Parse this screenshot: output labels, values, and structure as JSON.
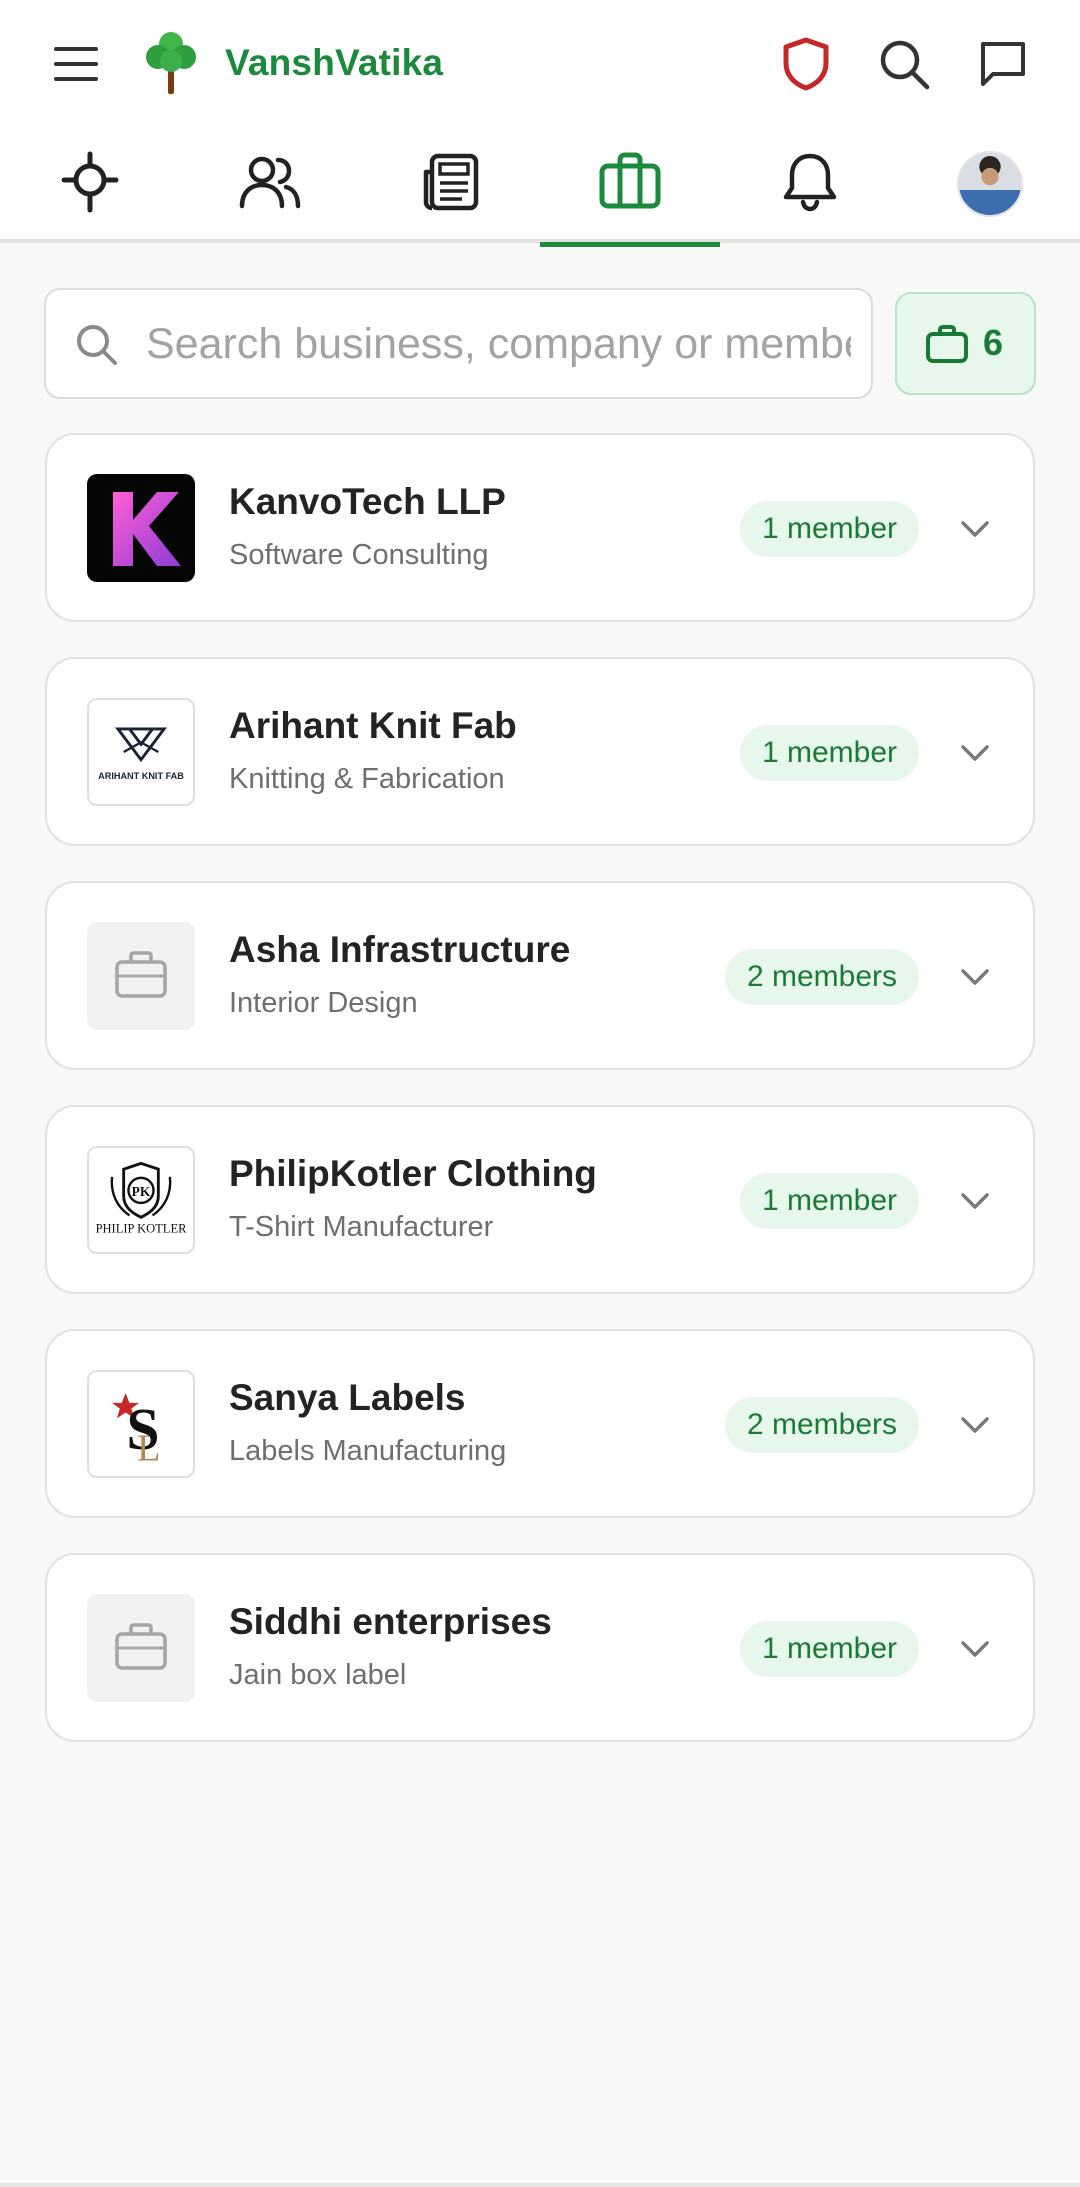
{
  "app": {
    "brand": "VanshVatika",
    "colors": {
      "brand_green": "#1c8a3d",
      "shield_red": "#c62828",
      "badge_bg": "#e8f7ec",
      "badge_text": "#1c7a37"
    }
  },
  "topbar": {
    "icons": [
      "menu-icon",
      "tree-logo",
      "shield-icon",
      "search-icon",
      "chat-icon"
    ]
  },
  "tabs": [
    {
      "id": "tree",
      "icon": "family-tree-icon"
    },
    {
      "id": "people",
      "icon": "people-icon"
    },
    {
      "id": "news",
      "icon": "newspaper-icon"
    },
    {
      "id": "business",
      "icon": "briefcase-icon",
      "active": true
    },
    {
      "id": "notifications",
      "icon": "bell-icon"
    },
    {
      "id": "profile",
      "icon": "avatar"
    }
  ],
  "search": {
    "placeholder": "Search business, company or member",
    "value": ""
  },
  "business_count": "6",
  "businesses": [
    {
      "name": "KanvoTech LLP",
      "category": "Software Consulting",
      "members": "1 member",
      "logo": "kanvotech-logo"
    },
    {
      "name": "Arihant Knit Fab",
      "category": "Knitting & Fabrication",
      "members": "1 member",
      "logo": "arihant-logo",
      "logo_text": "ARIHANT KNIT FAB"
    },
    {
      "name": "Asha Infrastructure",
      "category": "Interior Design",
      "members": "2 members",
      "logo": "briefcase-placeholder-icon"
    },
    {
      "name": "PhilipKotler Clothing",
      "category": "T-Shirt Manufacturer",
      "members": "1 member",
      "logo": "philipkotler-logo",
      "logo_text": "PHILIP KOTLER"
    },
    {
      "name": "Sanya Labels",
      "category": "Labels Manufacturing",
      "members": "2 members",
      "logo": "sanya-labels-logo"
    },
    {
      "name": "Siddhi enterprises",
      "category": "Jain box label",
      "members": "1 member",
      "logo": "briefcase-placeholder-icon"
    }
  ]
}
